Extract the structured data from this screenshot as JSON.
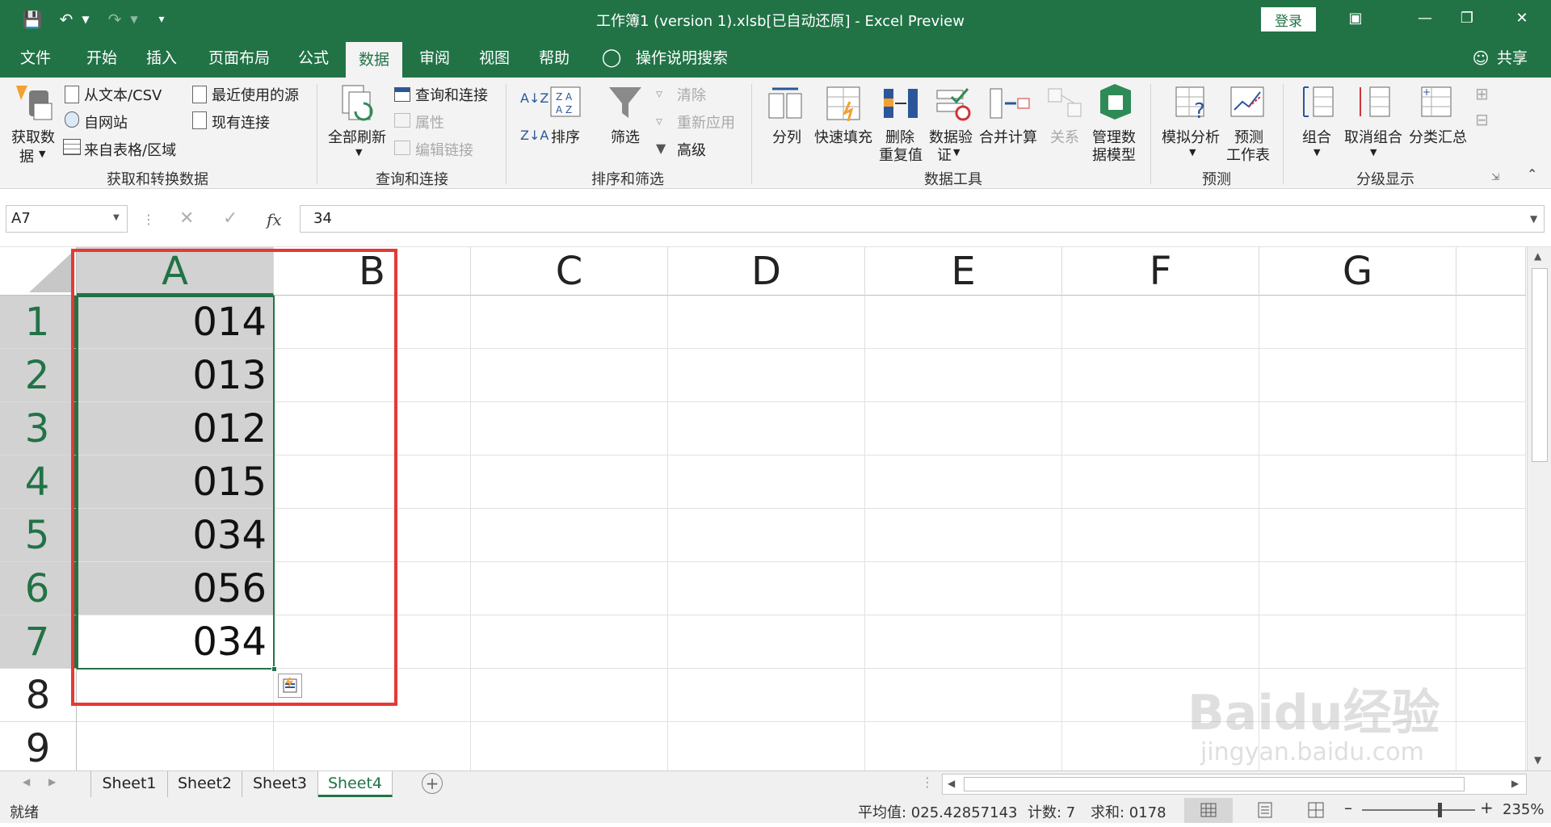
{
  "window": {
    "title": "工作簿1 (version 1).xlsb[已自动还原]  -  Excel Preview",
    "login_label": "登录"
  },
  "ribbon_tabs": [
    "文件",
    "开始",
    "插入",
    "页面布局",
    "公式",
    "数据",
    "审阅",
    "视图",
    "帮助"
  ],
  "tell_me": "操作说明搜索",
  "share_label": "共享",
  "ribbon": {
    "get_data": {
      "label_line1": "获取数",
      "label_line2": "据",
      "from_text": "从文本/CSV",
      "from_web": "自网站",
      "from_table": "来自表格/区域",
      "recent_sources": "最近使用的源",
      "existing_connections": "现有连接",
      "group_label": "获取和转换数据"
    },
    "queries": {
      "refresh_all": "全部刷新",
      "queries_connections": "查询和连接",
      "properties": "属性",
      "edit_links": "编辑链接",
      "group_label": "查询和连接"
    },
    "sort_filter": {
      "sort": "排序",
      "filter": "筛选",
      "clear": "清除",
      "reapply": "重新应用",
      "advanced": "高级",
      "group_label": "排序和筛选"
    },
    "data_tools": {
      "text_to_columns": "分列",
      "flash_fill": "快速填充",
      "remove_duplicates_line1": "删除",
      "remove_duplicates_line2": "重复值",
      "validation_line1": "数据验",
      "validation_line2": "证",
      "consolidate": "合并计算",
      "relationships": "关系",
      "data_model_line1": "管理数",
      "data_model_line2": "据模型",
      "group_label": "数据工具"
    },
    "forecast": {
      "what_if": "模拟分析",
      "forecast_sheet_line1": "预测",
      "forecast_sheet_line2": "工作表",
      "group_label": "预测"
    },
    "outline": {
      "group": "组合",
      "ungroup": "取消组合",
      "subtotal": "分类汇总",
      "group_label": "分级显示"
    }
  },
  "formula_bar": {
    "name_box": "A7",
    "content": "34",
    "fx": "fx"
  },
  "columns": [
    "A",
    "B",
    "C",
    "D",
    "E",
    "F",
    "G"
  ],
  "rows": [
    "1",
    "2",
    "3",
    "4",
    "5",
    "6",
    "7",
    "8",
    "9"
  ],
  "cells": {
    "A1": "014",
    "A2": "013",
    "A3": "012",
    "A4": "015",
    "A5": "034",
    "A6": "056",
    "A7": "034"
  },
  "sheets": [
    "Sheet1",
    "Sheet2",
    "Sheet3",
    "Sheet4"
  ],
  "active_sheet": "Sheet4",
  "status": {
    "ready": "就绪",
    "average": "平均值: 025.42857143",
    "count": "计数: 7",
    "sum": "求和: 0178",
    "zoom": "235%"
  },
  "watermark": {
    "line1": "Baidu经验",
    "line2": "jingyan.baidu.com"
  },
  "colors": {
    "excel_green": "#217346",
    "highlight_red": "#e53935",
    "selection_gray": "#d2d2d2"
  }
}
